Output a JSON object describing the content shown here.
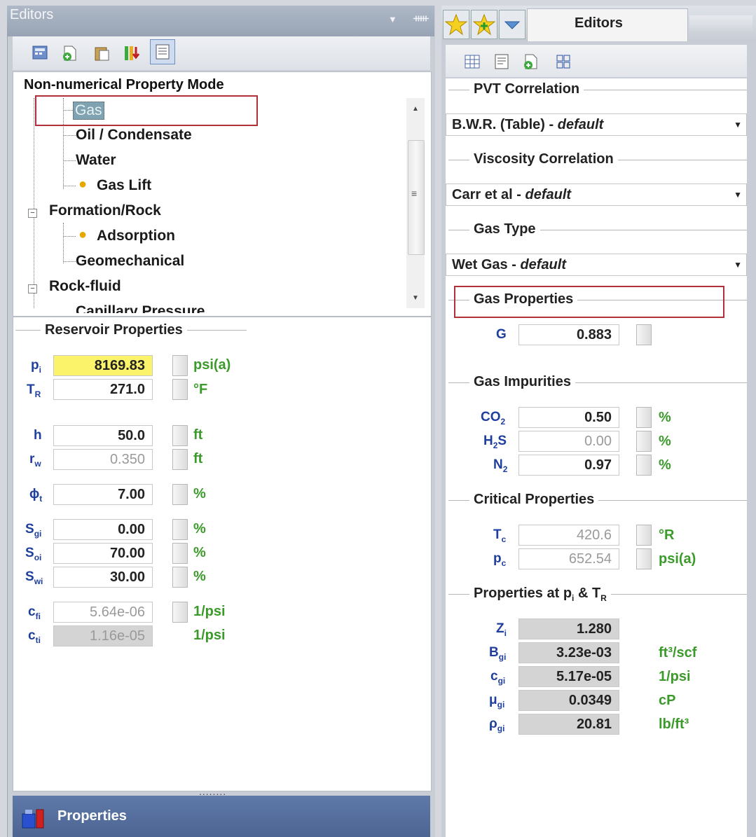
{
  "left_pane": {
    "title": "Editors",
    "title_buttons": {
      "dropdown": "▼",
      "pin": "ᚔ"
    },
    "tree": {
      "header": "Non-numerical Property Mode",
      "items": [
        {
          "label": "Gas"
        },
        {
          "label": "Oil / Condensate"
        },
        {
          "label": "Water"
        },
        {
          "label": "Gas Lift"
        },
        {
          "label": "Formation/Rock"
        },
        {
          "label": "Adsorption"
        },
        {
          "label": "Geomechanical"
        },
        {
          "label": "Rock-fluid"
        },
        {
          "label": "Capillary Pressure"
        }
      ]
    },
    "reservoir": {
      "title": "Reservoir Properties",
      "rows": [
        {
          "sym": "p",
          "sub": "i",
          "value": "8169.83",
          "unit": "psi(a)"
        },
        {
          "sym": "T",
          "sub": "R",
          "value": "271.0",
          "unit": "°F"
        },
        {
          "sym": "h",
          "sub": "",
          "value": "50.0",
          "unit": "ft"
        },
        {
          "sym": "r",
          "sub": "w",
          "value": "0.350",
          "unit": "ft"
        },
        {
          "sym": "ϕ",
          "sub": "t",
          "value": "7.00",
          "unit": "%"
        },
        {
          "sym": "S",
          "sub": "gi",
          "value": "0.00",
          "unit": "%"
        },
        {
          "sym": "S",
          "sub": "oi",
          "value": "70.00",
          "unit": "%"
        },
        {
          "sym": "S",
          "sub": "wi",
          "value": "30.00",
          "unit": "%"
        },
        {
          "sym": "c",
          "sub": "fi",
          "value": "5.64e-06",
          "unit": "1/psi"
        },
        {
          "sym": "c",
          "sub": "ti",
          "value": "1.16e-05",
          "unit": "1/psi"
        }
      ]
    },
    "grip": "........",
    "properties_bar": "Properties"
  },
  "right_pane": {
    "tab_title": "Editors",
    "pvt": {
      "title": "PVT Correlation",
      "value": "B.W.R. (Table) - ",
      "value_italic": "default"
    },
    "viscosity": {
      "title": "Viscosity Correlation",
      "value": "Carr et al - ",
      "value_italic": "default"
    },
    "gas_type": {
      "title": "Gas Type",
      "value": "Wet Gas - ",
      "value_italic": "default"
    },
    "gas_props": {
      "title": "Gas Properties",
      "label": "G",
      "value": "0.883"
    },
    "impurities": {
      "title": "Gas Impurities",
      "rows": [
        {
          "sym": "CO",
          "sub": "2",
          "tail": "",
          "value": "0.50",
          "unit": "%"
        },
        {
          "sym": "H",
          "sub": "2",
          "tail": "S",
          "value": "0.00",
          "unit": "%"
        },
        {
          "sym": "N",
          "sub": "2",
          "tail": "",
          "value": "0.97",
          "unit": "%"
        }
      ]
    },
    "critical": {
      "title": "Critical Properties",
      "rows": [
        {
          "sym": "T",
          "sub": "c",
          "value": "420.6",
          "unit": "°R"
        },
        {
          "sym": "p",
          "sub": "c",
          "value": "652.54",
          "unit": "psi(a)"
        }
      ]
    },
    "at_pi_tr": {
      "title_a": "Properties at p",
      "title_sub1": "i",
      "title_b": " & T",
      "title_sub2": "R",
      "rows": [
        {
          "sym": "Z",
          "sub": "i",
          "value": "1.280",
          "unit": ""
        },
        {
          "sym": "B",
          "sub": "gi",
          "value": "3.23e-03",
          "unit": "ft³/scf"
        },
        {
          "sym": "c",
          "sub": "gi",
          "value": "5.17e-05",
          "unit": "1/psi"
        },
        {
          "sym": "μ",
          "sub": "gi",
          "value": "0.0349",
          "unit": "cP"
        },
        {
          "sym": "ρ",
          "sub": "gi",
          "value": "20.81",
          "unit": "lb/ft³"
        }
      ]
    }
  },
  "colors": {
    "highlight": "#b0303a",
    "unit_green": "#3a9a2a",
    "label_blue": "#1f3f9f",
    "pi_yellow": "#fbf36a"
  }
}
